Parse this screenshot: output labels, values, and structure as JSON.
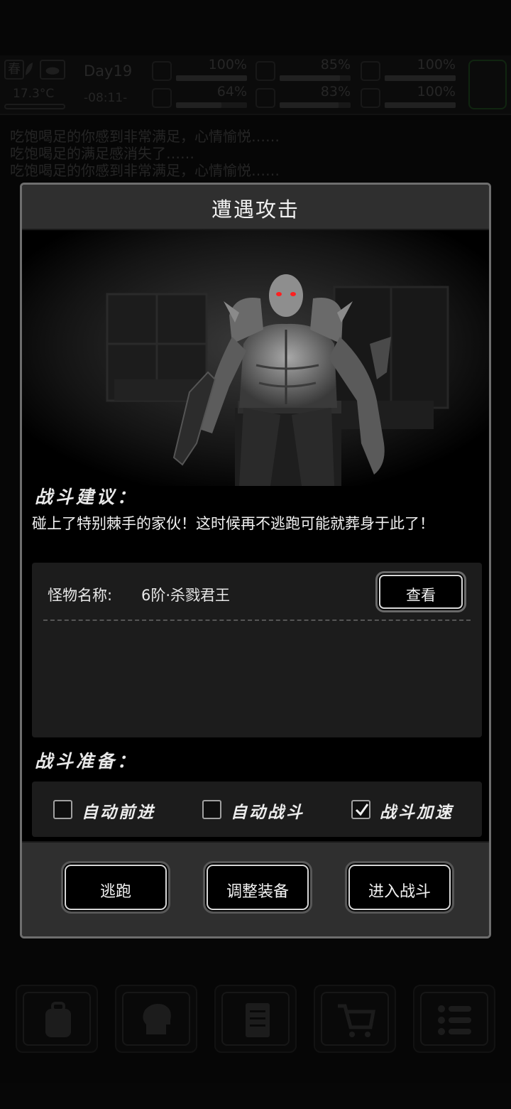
{
  "status_bar": {
    "season": "春",
    "temperature": "17.3°C",
    "day": "Day19",
    "time": "-08:11-",
    "stats": [
      {
        "icon": "medkit-icon",
        "value": "100%",
        "level": 1.0
      },
      {
        "icon": "stomach-icon",
        "value": "85%",
        "level": 0.85
      },
      {
        "icon": "mental-icon",
        "value": "100%",
        "level": 1.0
      },
      {
        "icon": "boot-icon",
        "value": "64%",
        "level": 0.64
      },
      {
        "icon": "water-drop-icon",
        "value": "83%",
        "level": 0.83
      },
      {
        "icon": "heart-icon",
        "value": "100%",
        "level": 1.0
      }
    ]
  },
  "log": {
    "lines": [
      "吃饱喝足的你感到非常满足，心情愉悦……",
      "吃饱喝足的满足感消失了……",
      "吃饱喝足的你感到非常满足，心情愉悦……"
    ]
  },
  "dialog": {
    "title": "遭遇攻击",
    "advice_heading": "战斗建议：",
    "advice_text": "碰上了特别棘手的家伙！这时候再不逃跑可能就葬身于此了！",
    "monster_label": "怪物名称:",
    "monster_name": "6阶·杀戮君王",
    "view_button": "查看",
    "prep_heading": "战斗准备：",
    "options": [
      {
        "label": "自动前进",
        "checked": false
      },
      {
        "label": "自动战斗",
        "checked": false
      },
      {
        "label": "战斗加速",
        "checked": true
      }
    ],
    "actions": {
      "flee": "逃跑",
      "adjust_gear": "调整装备",
      "enter_battle": "进入战斗"
    }
  },
  "bottom_nav": [
    "backpack-icon",
    "brain-icon",
    "notebook-icon",
    "shop-cart-icon",
    "menu-list-icon"
  ]
}
